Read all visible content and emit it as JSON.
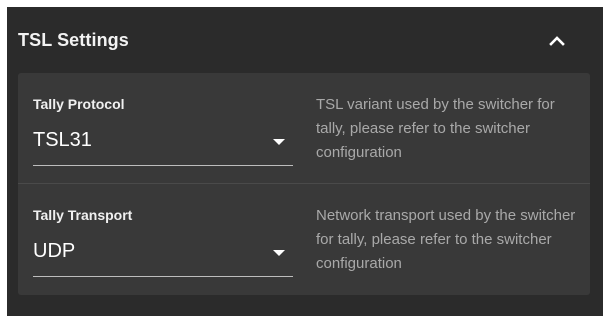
{
  "panel": {
    "title": "TSL Settings",
    "collapse_icon": "chevron-up-icon"
  },
  "fields": [
    {
      "label": "Tally Protocol",
      "value": "TSL31",
      "help": "TSL variant used by the switcher for tally, please refer to the switcher configuration"
    },
    {
      "label": "Tally Transport",
      "value": "UDP",
      "help": "Network transport used by the switcher for tally, please refer to the switcher configuration"
    }
  ],
  "colors": {
    "panel_bg": "#2b2b2b",
    "card_bg": "#393939",
    "text": "#ffffff",
    "help_text": "#a9a9a9"
  }
}
